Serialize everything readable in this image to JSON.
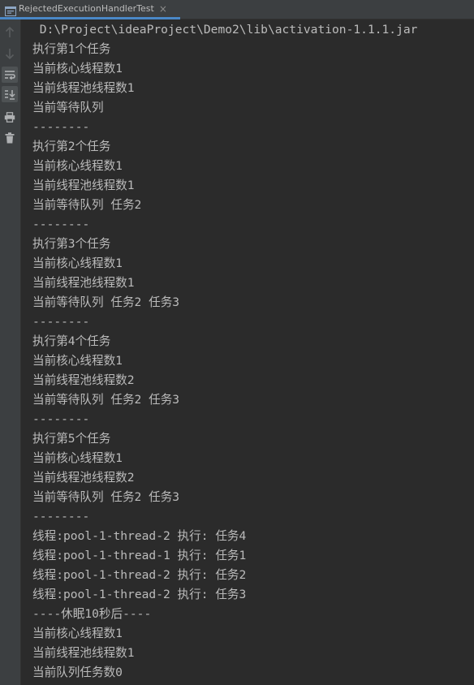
{
  "tab": {
    "title": "RejectedExecutionHandlerTest",
    "close_glyph": "×",
    "icon": "run-config-icon"
  },
  "toolbar": {
    "items": [
      {
        "name": "up-arrow-icon",
        "active": false
      },
      {
        "name": "down-arrow-icon",
        "active": false
      },
      {
        "name": "soft-wrap-icon",
        "active": true
      },
      {
        "name": "scroll-to-end-icon",
        "active": true
      },
      {
        "name": "print-icon",
        "active": false
      },
      {
        "name": "trash-icon",
        "active": false
      }
    ]
  },
  "colors": {
    "background": "#2b2b2b",
    "text": "#bbbbbb",
    "toolbar": "#3c3f41",
    "tab_underline": "#4a88c7"
  },
  "console": {
    "lines": [
      " D:\\Project\\ideaProject\\Demo2\\lib\\activation-1.1.1.jar",
      "执行第1个任务",
      "当前核心线程数1",
      "当前线程池线程数1",
      "当前等待队列",
      "--------",
      "执行第2个任务",
      "当前核心线程数1",
      "当前线程池线程数1",
      "当前等待队列 任务2",
      "--------",
      "执行第3个任务",
      "当前核心线程数1",
      "当前线程池线程数1",
      "当前等待队列 任务2 任务3",
      "--------",
      "执行第4个任务",
      "当前核心线程数1",
      "当前线程池线程数2",
      "当前等待队列 任务2 任务3",
      "--------",
      "执行第5个任务",
      "当前核心线程数1",
      "当前线程池线程数2",
      "当前等待队列 任务2 任务3",
      "--------",
      "线程:pool-1-thread-2 执行: 任务4",
      "线程:pool-1-thread-1 执行: 任务1",
      "线程:pool-1-thread-2 执行: 任务2",
      "线程:pool-1-thread-2 执行: 任务3",
      "----休眠10秒后----",
      "当前核心线程数1",
      "当前线程池线程数1",
      "当前队列任务数0"
    ]
  }
}
